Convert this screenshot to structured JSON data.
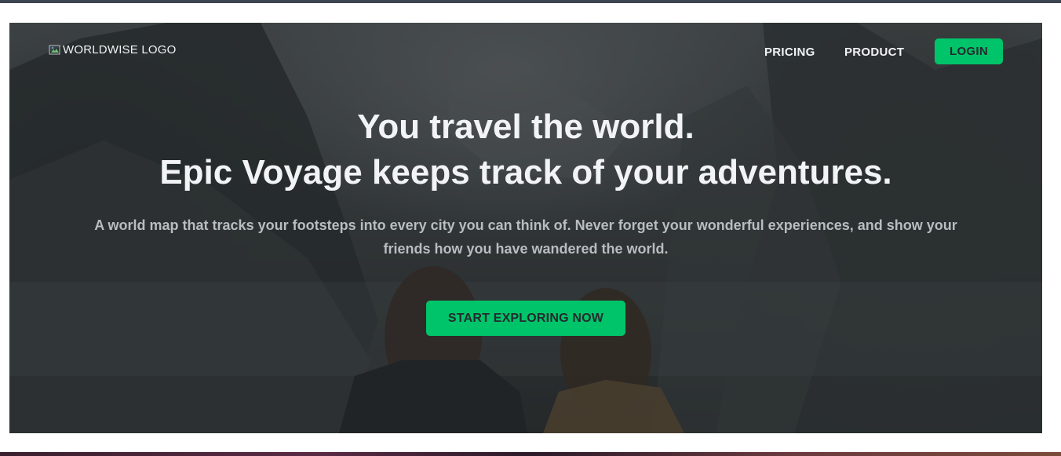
{
  "nav": {
    "logo_alt": "WORLDWISE LOGO",
    "links": [
      {
        "label": "PRICING"
      },
      {
        "label": "PRODUCT"
      }
    ],
    "login_label": "LOGIN"
  },
  "hero": {
    "headline_line1": "You travel the world.",
    "headline_line2": "Epic Voyage keeps track of your adventures.",
    "subtext": "A world map that tracks your footsteps into every city you can think of. Never forget your wonderful experiences, and show your friends how you have wandered the world.",
    "cta_label": "START EXPLORING NOW"
  },
  "colors": {
    "accent": "#00c46a",
    "text_light": "#f1f3f5",
    "text_muted": "#b8bdc2",
    "button_text": "#242a2e",
    "background_dark": "#2d3439"
  },
  "icons": {
    "logo": "broken-image-icon"
  }
}
